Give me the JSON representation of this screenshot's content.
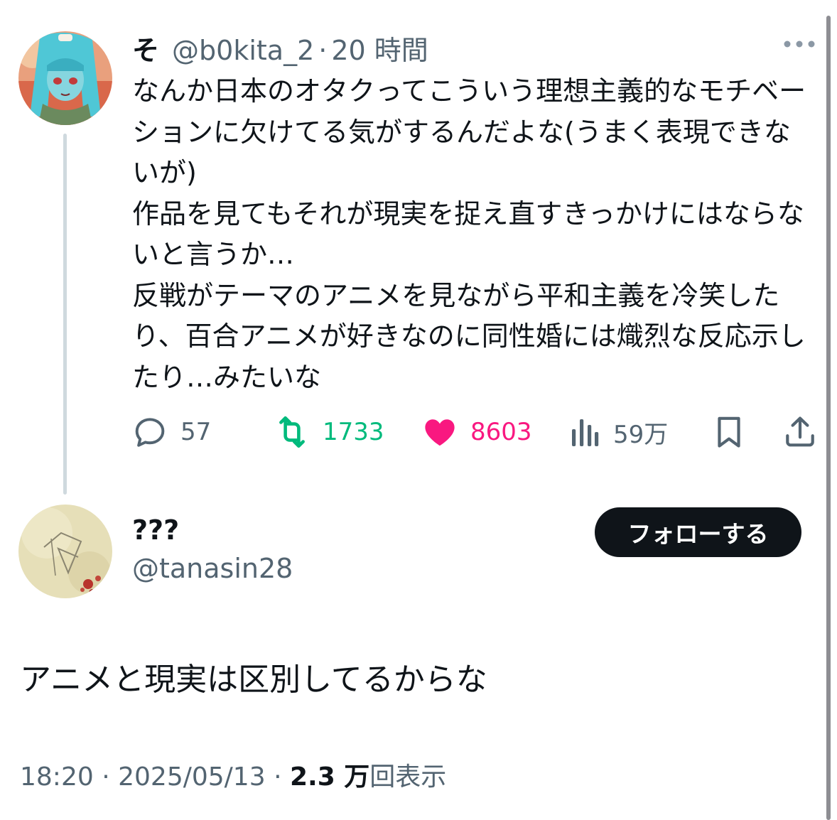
{
  "post": {
    "display_name": "そ",
    "handle": "@b0kita_2",
    "separator": "·",
    "time": "20 時間",
    "more_icon": "more-dots-icon",
    "text": "なんか日本のオタクってこういう理想主義的なモチベーションに欠けてる気がするんだよな(うまく表現できないが)\n作品を見てもそれが現実を捉え直すきっかけにはならないと言うか…\n反戦がテーマのアニメを見ながら平和主義を冷笑したり、百合アニメが好きなのに同性婚には熾烈な反応示したり…みたいな",
    "actions": {
      "replies": "57",
      "retweets": "1733",
      "likes": "8603",
      "views": "59万"
    },
    "colors": {
      "retweet": "#00ba7c",
      "like": "#f91880",
      "secondary": "#536471"
    }
  },
  "reply": {
    "display_name": "???",
    "handle": "@tanasin28",
    "follow_label": "フォローする",
    "text": "アニメと現実は区別してるからな",
    "meta": {
      "time": "18:20",
      "separator": "·",
      "date": "2025/05/13",
      "view_count": "2.3 万",
      "views_label": "回表示"
    }
  }
}
